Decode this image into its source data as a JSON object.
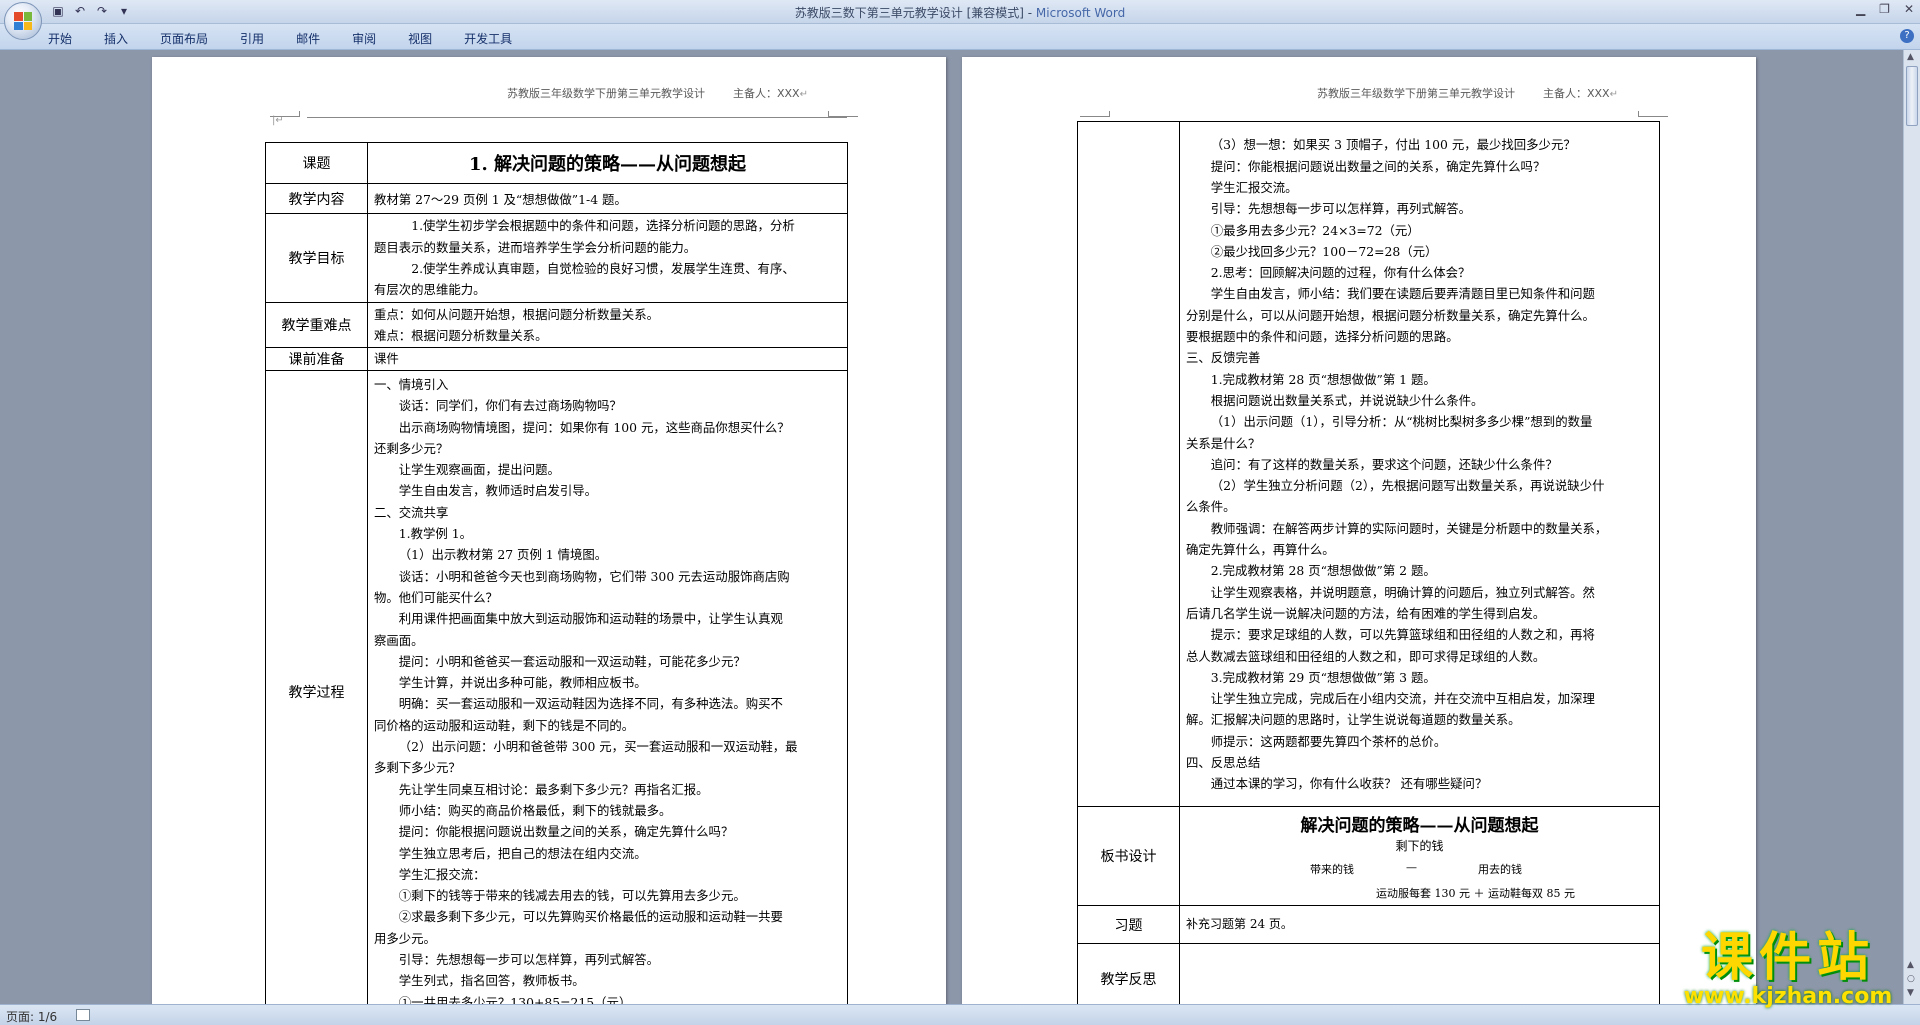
{
  "window": {
    "title": "苏教版三数下第三单元教学设计 [兼容模式] - ",
    "app": "Microsoft Word"
  },
  "ribbon_tabs": [
    "开始",
    "插入",
    "页面布局",
    "引用",
    "邮件",
    "审阅",
    "视图",
    "开发工具"
  ],
  "status": {
    "page": "页面: 1/6"
  },
  "colors": {
    "titlebar": "#dfe8f5",
    "workspace": "#8d97aa"
  },
  "page1": {
    "header": "苏教版三年级数学下册第三单元教学设计",
    "header_author": "主备人：XXX",
    "rows": [
      {
        "label": "课题",
        "title": "1. 解决问题的策略——从问题想起"
      },
      {
        "label": "教学内容",
        "text": "教材第 27～29 页例 1 及“想想做做”1-4 题。"
      },
      {
        "label": "教学目标",
        "lines": [
          "1.使学生初步学会根据题中的条件和问题，选择分析问题的思路，分析",
          "题目表示的数量关系，进而培养学生学会分析问题的能力。",
          "2.使学生养成认真审题，自觉检验的良好习惯，发展学生连贯、有序、",
          "有层次的思维能力。"
        ]
      },
      {
        "label": "教学重难点",
        "lines": [
          "重点：如何从问题开始想，根据问题分析数量关系。",
          "难点：根据问题分析数量关系。"
        ]
      },
      {
        "label": "课前准备",
        "text": "课件"
      },
      {
        "label": "教学过程",
        "lines": [
          "一、情境引入",
          "谈话：同学们，你们有去过商场购物吗？",
          "出示商场购物情境图，提问：如果你有 100 元，这些商品你想买什么？",
          "还剩多少元？",
          "让学生观察画面，提出问题。",
          "学生自由发言，教师适时启发引导。",
          "二、交流共享",
          "1.教学例 1。",
          "（1）出示教材第 27 页例 1 情境图。",
          "谈话：小明和爸爸今天也到商场购物，它们带 300 元去运动服饰商店购",
          "物。他们可能买什么？",
          "利用课件把画面集中放大到运动服饰和运动鞋的场景中，让学生认真观",
          "察画面。",
          "提问：小明和爸爸买一套运动服和一双运动鞋，可能花多少元？",
          "学生计算，并说出多种可能，教师相应板书。",
          "明确：买一套运动服和一双运动鞋因为选择不同，有多种选法。购买不",
          "同价格的运动服和运动鞋，剩下的钱是不同的。",
          "（2）出示问题：小明和爸爸带 300 元，买一套运动服和一双运动鞋，最",
          "多剩下多少元？",
          "先让学生同桌互相讨论：最多剩下多少元？再指名汇报。",
          "师小结：购买的商品价格最低，剩下的钱就最多。",
          "提问：你能根据问题说出数量之间的关系，确定先算什么吗？",
          "学生独立思考后，把自己的想法在组内交流。",
          "学生汇报交流：",
          "①剩下的钱等于带来的钱减去用去的钱，可以先算用去多少元。",
          "②求最多剩下多少元，可以先算购买价格最低的运动服和运动鞋一共要",
          "用多少元。",
          "引导：先想想每一步可以怎样算，再列式解答。",
          "学生列式，指名回答，教师板书。",
          "①一共用去多少元？130+85=215（元）"
        ]
      }
    ]
  },
  "page2": {
    "header": "苏教版三年级数学下册第三单元教学设计",
    "header_author": "主备人：XXX",
    "process_lines": [
      "（3）想一想：如果买 3 顶帽子，付出 100 元，最少找回多少元？",
      "提问：你能根据问题说出数量之间的关系，确定先算什么吗？",
      "学生汇报交流。",
      "引导：先想想每一步可以怎样算，再列式解答。",
      "①最多用去多少元？24×3=72（元）",
      "②最少找回多少元？100－72=28（元）",
      "2.思考：回顾解决问题的过程，你有什么体会？",
      "学生自由发言，师小结：我们要在读题后要弄清题目里已知条件和问题",
      "分别是什么，可以从问题开始想，根据问题分析数量关系，确定先算什么。",
      "要根据题中的条件和问题，选择分析问题的思路。",
      "三、反馈完善",
      "1.完成教材第 28 页“想想做做”第 1 题。",
      "根据问题说出数量关系式，并说说缺少什么条件。",
      "（1）出示问题（1），引导分析：从“桃树比梨树多多少棵”想到的数量",
      "关系是什么？",
      "追问：有了这样的数量关系，要求这个问题，还缺少什么条件？",
      "（2）学生独立分析问题（2），先根据问题写出数量关系，再说说缺少什",
      "么条件。",
      "教师强调：在解答两步计算的实际问题时，关键是分析题中的数量关系，",
      "确定先算什么，再算什么。",
      "2.完成教材第 28 页“想想做做”第 2 题。",
      "让学生观察表格，并说明题意，明确计算的问题后，独立列式解答。然",
      "后请几名学生说一说解决问题的方法，给有困难的学生得到启发。",
      "提示：要求足球组的人数，可以先算篮球组和田径组的人数之和，再将",
      "总人数减去篮球组和田径组的人数之和，即可求得足球组的人数。",
      "3.完成教材第 29 页“想想做做”第 3 题。",
      "让学生独立完成，完成后在小组内交流，并在交流中互相启发，加深理",
      "解。汇报解决问题的思路时，让学生说说每道题的数量关系。",
      "师提示：这两题都要先算四个茶杯的总价。",
      "四、反思总结",
      "通过本课的学习，你有什么收获？ 还有哪些疑问？"
    ],
    "board": {
      "label": "板书设计",
      "title": "解决问题的策略——从问题想起",
      "sub": "剩下的钱",
      "eq_left": "带来的钱",
      "eq_op": "—",
      "eq_right": "用去的钱",
      "eq2": "运动服每套 130 元 ＋ 运动鞋每双 85 元"
    },
    "exercise": {
      "label": "习题",
      "text": "补充习题第 24 页。"
    },
    "reflection": {
      "label": "教学反思"
    }
  },
  "watermark": {
    "text": "课件站",
    "url": "www.kjzhan.com"
  }
}
